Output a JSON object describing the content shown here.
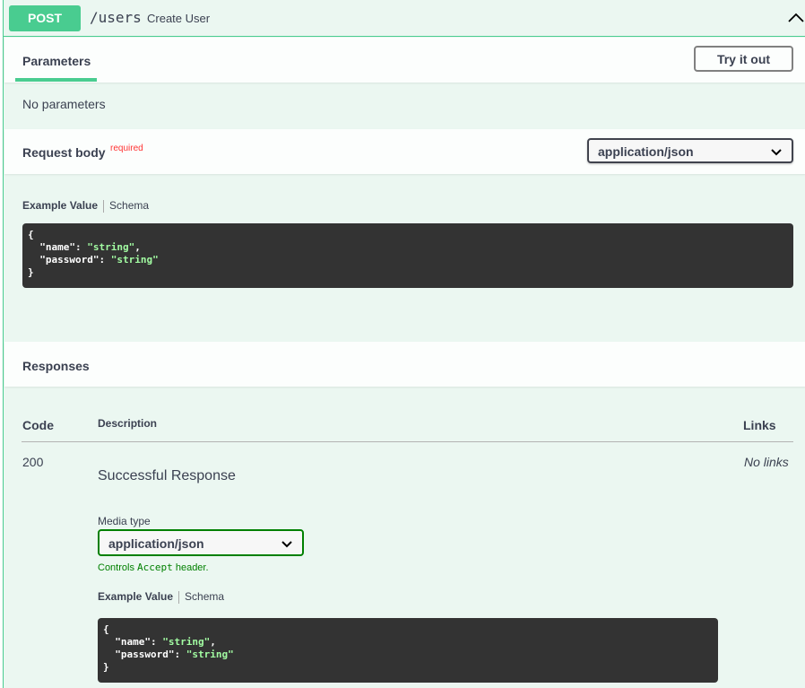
{
  "summary": {
    "method": "POST",
    "path": "/users",
    "description": "Create User"
  },
  "parameters": {
    "tab_label": "Parameters",
    "try_it_out": "Try it out",
    "empty_text": "No parameters"
  },
  "request_body": {
    "title": "Request body",
    "required": "required",
    "content_type": "application/json",
    "example_tab": "Example Value",
    "schema_tab": "Schema",
    "example_lines": [
      "{",
      "  \"name\": \"string\",",
      "  \"password\": \"string\"",
      "}"
    ]
  },
  "responses": {
    "title": "Responses",
    "columns": {
      "code": "Code",
      "description": "Description",
      "links": "Links"
    },
    "rows": [
      {
        "code": "200",
        "description": "Successful Response",
        "links": "No links",
        "media_type_label": "Media type",
        "media_type": "application/json",
        "controls_prefix": "Controls ",
        "controls_mono": "Accept",
        "controls_suffix": " header.",
        "example_tab": "Example Value",
        "schema_tab": "Schema"
      }
    ]
  },
  "colors": {
    "method_post": "#49cc90",
    "block_bg": "#ebf7f1",
    "code_bg": "#333333",
    "code_string": "#a2fca2",
    "required": "#ff3333"
  }
}
